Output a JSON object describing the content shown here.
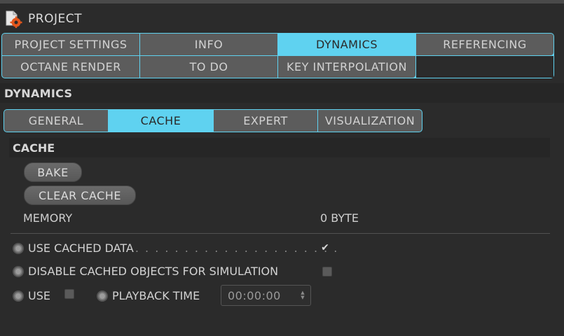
{
  "window": {
    "title": "PROJECT"
  },
  "main_tabs": [
    {
      "label": "PROJECT SETTINGS",
      "active": false
    },
    {
      "label": "INFO",
      "active": false
    },
    {
      "label": "DYNAMICS",
      "active": true
    },
    {
      "label": "REFERENCING",
      "active": false
    },
    {
      "label": "OCTANE RENDER",
      "active": false
    },
    {
      "label": "TO DO",
      "active": false
    },
    {
      "label": "KEY INTERPOLATION",
      "active": false
    }
  ],
  "section": {
    "title": "DYNAMICS"
  },
  "sub_tabs": [
    {
      "label": "GENERAL",
      "active": false
    },
    {
      "label": "CACHE",
      "active": true
    },
    {
      "label": "EXPERT",
      "active": false
    },
    {
      "label": "VISUALIZATION",
      "active": false
    }
  ],
  "cache": {
    "title": "CACHE",
    "bake_label": "BAKE",
    "clear_label": "CLEAR CACHE",
    "memory_label": "MEMORY",
    "memory_value": "0 BYTE",
    "use_cached_label": "USE CACHED DATA",
    "use_cached_dots": ". . . . . . . . . . . . . . . . . . . . .",
    "use_cached_checked": true,
    "disable_label": "DISABLE CACHED OBJECTS FOR SIMULATION",
    "disable_checked": false,
    "use_label": "USE",
    "use_checked": false,
    "playback_label": "PLAYBACK TIME",
    "playback_value": "00:00:00"
  },
  "colors": {
    "accent": "#5fd2f0",
    "background": "#2b2b2b",
    "tab": "#5c5c5c"
  },
  "icons": {
    "project": "project-settings-icon",
    "checkmark": "checkmark-icon"
  }
}
